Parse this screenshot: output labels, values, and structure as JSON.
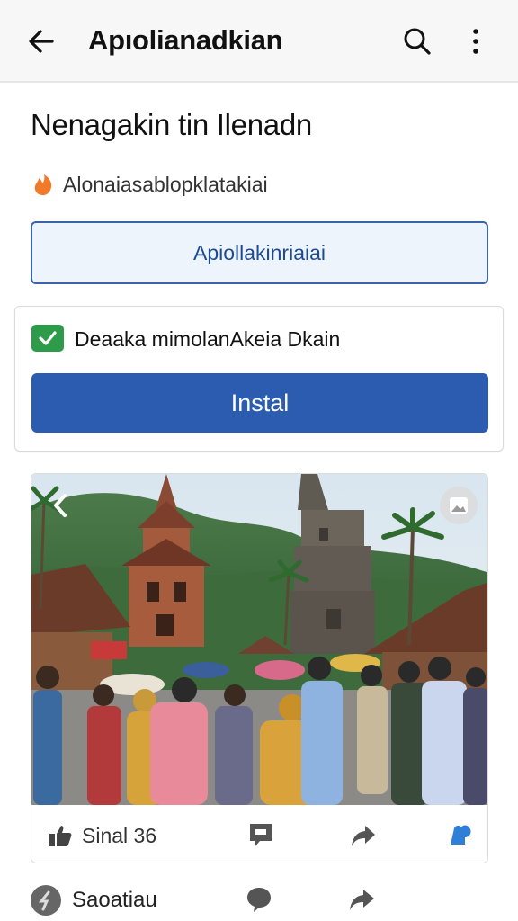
{
  "app_bar": {
    "title": "Apıolianadkian",
    "icons": [
      "back-arrow-icon",
      "search-icon",
      "more-vert-icon"
    ]
  },
  "headline": "Nenagakin tin Ilenadn",
  "subline": {
    "icon": "flame-icon",
    "text": "Alonaiasablopklatakiai",
    "icon_color": "#f07a2a"
  },
  "outline_button": {
    "label": "Apiollakinriaiai"
  },
  "install_card": {
    "checkbox_label": "Deaaka mimolanAkeia Dkain",
    "checked": true,
    "install_label": "Instal",
    "accent": "#2b5cb0",
    "check_color": "#2e9b4a"
  },
  "post": {
    "image_subject": "photo",
    "like_label": "Sinal 36",
    "icons": [
      "like-icon",
      "comment-icon",
      "share-icon",
      "save-icon"
    ]
  },
  "bottom_row": {
    "name": "Saoatiau",
    "icons": [
      "avatar-icon",
      "comment-icon",
      "share-icon"
    ]
  }
}
